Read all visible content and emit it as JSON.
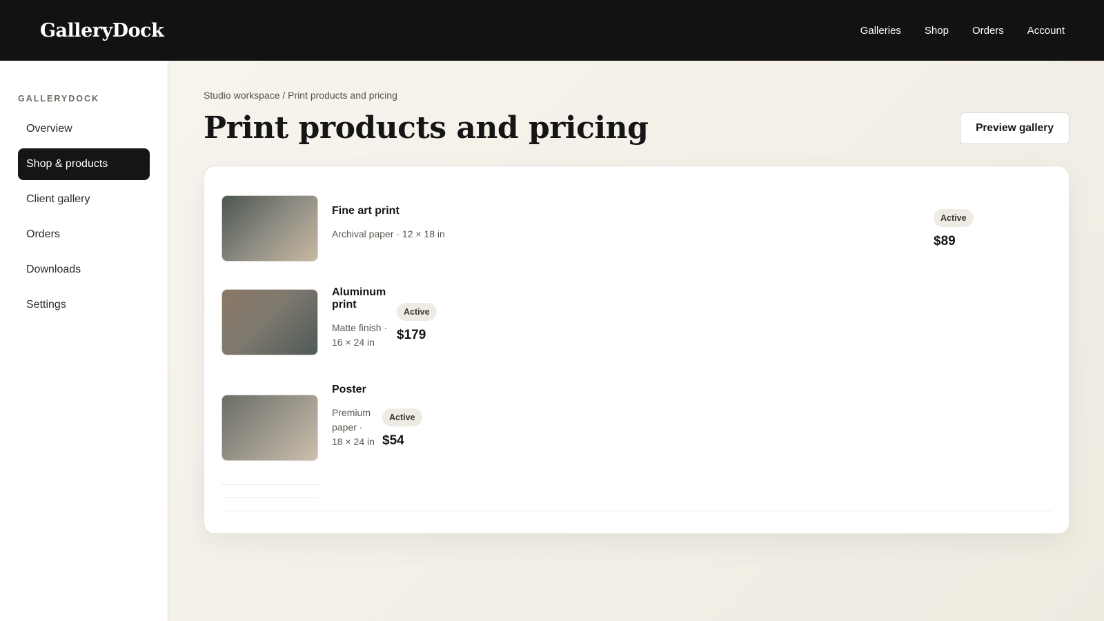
{
  "app": {
    "brand": "GalleryDock",
    "top_nav": [
      "Galleries",
      "Shop",
      "Orders",
      "Account"
    ]
  },
  "sidebar": {
    "heading": "GALLERYDOCK",
    "items": [
      {
        "label": "Overview",
        "active": false
      },
      {
        "label": "Shop & products",
        "active": true
      },
      {
        "label": "Client gallery",
        "active": false
      },
      {
        "label": "Orders",
        "active": false
      },
      {
        "label": "Downloads",
        "active": false
      },
      {
        "label": "Settings",
        "active": false
      }
    ]
  },
  "main": {
    "breadcrumb": "Studio workspace / Print products and pricing",
    "title": "Print products and pricing",
    "preview_button": "Preview gallery",
    "products": [
      {
        "name": "Fine art print",
        "description": "Archival paper · 12 × 18 in",
        "status": "Active",
        "price": "$89"
      },
      {
        "name": "Aluminum print",
        "description": "Matte finish · 16 × 24 in",
        "status": "Active",
        "price": "$179"
      },
      {
        "name": "Poster",
        "description": "Premium paper · 18 × 24 in",
        "status": "Active",
        "price": "$54"
      }
    ]
  },
  "colors": {
    "topbar": "#121212",
    "active_nav": "#151515",
    "badge": "#eeebe4"
  }
}
